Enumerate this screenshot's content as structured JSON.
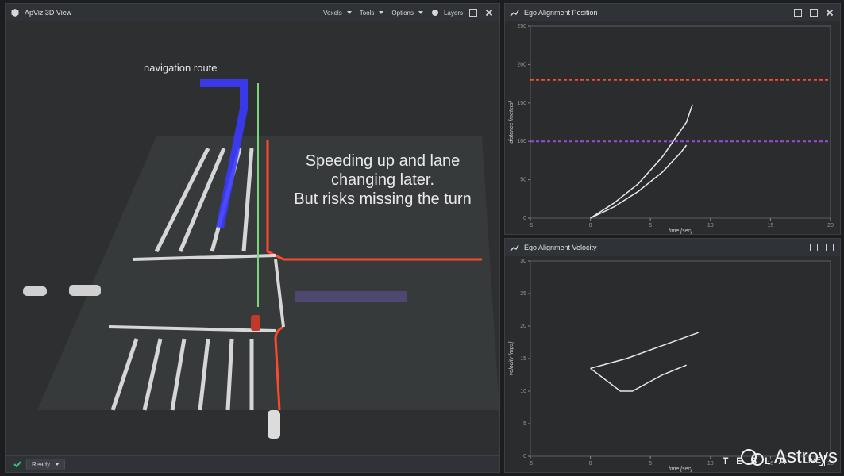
{
  "left_panel": {
    "title": "ApViz 3D View",
    "menus": [
      "Voxels",
      "Tools",
      "Options",
      "Layers"
    ],
    "status_label": "Ready",
    "annotations": {
      "nav_route": "navigation route",
      "overlay_line1": "Speeding up and lane",
      "overlay_line2": "changing later.",
      "overlay_line3": "But risks missing the turn"
    }
  },
  "right_top_panel": {
    "title": "Ego Alignment Position"
  },
  "right_bottom_panel": {
    "title": "Ego Alignment Velocity"
  },
  "watermark": {
    "channel": "Astroys",
    "brand": "TESLA",
    "live": "LIVE"
  },
  "colors": {
    "route": "#3b3bff",
    "red_line": "#ff4a2a",
    "purple_line": "#9a4bd6",
    "curve": "#e8e8e8"
  },
  "chart_data": [
    {
      "type": "line",
      "x": [],
      "series": [
        {
          "values": [
            [
              0,
              0
            ],
            [
              2,
              20
            ],
            [
              4,
              45
            ],
            [
              6,
              80
            ],
            [
              8,
              125
            ],
            [
              8.5,
              148
            ]
          ]
        },
        {
          "values": [
            [
              0,
              0
            ],
            [
              2,
              15
            ],
            [
              4,
              35
            ],
            [
              6,
              60
            ],
            [
              7.5,
              85
            ],
            [
              8,
              95
            ]
          ]
        }
      ],
      "xlabel": "time [sec]",
      "ylabel": "distance [meters]",
      "xlim": [
        -5,
        20
      ],
      "ylim": [
        0,
        250
      ],
      "xticks": [
        -5,
        0,
        5,
        10,
        15,
        20
      ],
      "yticks": [
        0,
        50,
        100,
        150,
        200,
        250
      ],
      "hlines": [
        {
          "y": 180,
          "color": "#ff4a2a"
        },
        {
          "y": 100,
          "color": "#9a4bd6"
        }
      ]
    },
    {
      "type": "line",
      "series": [
        {
          "values": [
            [
              0,
              13.5
            ],
            [
              3,
              15
            ],
            [
              6,
              17
            ],
            [
              9,
              19
            ]
          ]
        },
        {
          "values": [
            [
              0,
              13.5
            ],
            [
              2.5,
              10
            ],
            [
              3.5,
              10
            ],
            [
              6,
              12.5
            ],
            [
              8,
              14
            ]
          ]
        }
      ],
      "xlabel": "time [sec]",
      "ylabel": "velocity [mps]",
      "xlim": [
        -5,
        20
      ],
      "ylim": [
        0,
        30
      ],
      "xticks": [
        -5,
        0,
        5,
        10,
        15,
        20
      ],
      "yticks": [
        0,
        5,
        10,
        15,
        20,
        25,
        30
      ]
    }
  ]
}
